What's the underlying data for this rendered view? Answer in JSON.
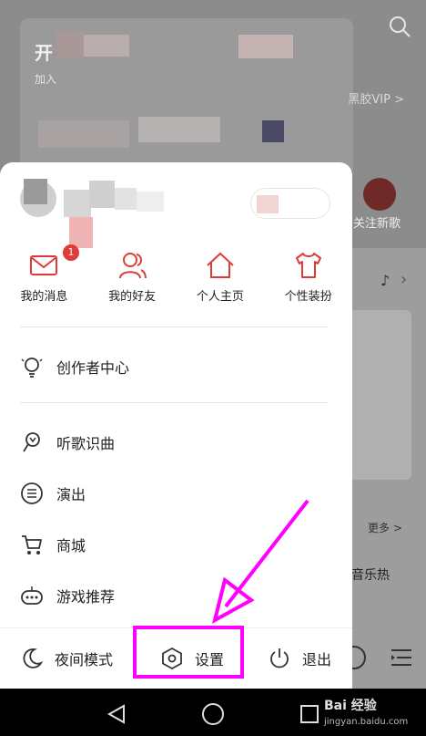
{
  "background": {
    "card_title": "开",
    "card_subtitle": "加入",
    "vip_text": "黑胶VIP >",
    "follow_text": "关注新歌",
    "more_text": "更多 >",
    "hot_text": "音乐热"
  },
  "quick_actions": [
    {
      "label": "我的消息",
      "icon": "mail-icon",
      "badge": "1"
    },
    {
      "label": "我的好友",
      "icon": "friends-icon"
    },
    {
      "label": "个人主页",
      "icon": "home-icon"
    },
    {
      "label": "个性装扮",
      "icon": "tshirt-icon"
    }
  ],
  "menu": {
    "creator": "创作者中心",
    "recognize": "听歌识曲",
    "concert": "演出",
    "mall": "商城",
    "games": "游戏推荐"
  },
  "bottom": {
    "night_mode": "夜间模式",
    "settings": "设置",
    "logout": "退出"
  },
  "watermark": {
    "logo": "Bai 经验",
    "url": "jingyan.baidu.com"
  },
  "colors": {
    "accent": "#e03b3b",
    "annotation": "#ff00ff"
  }
}
